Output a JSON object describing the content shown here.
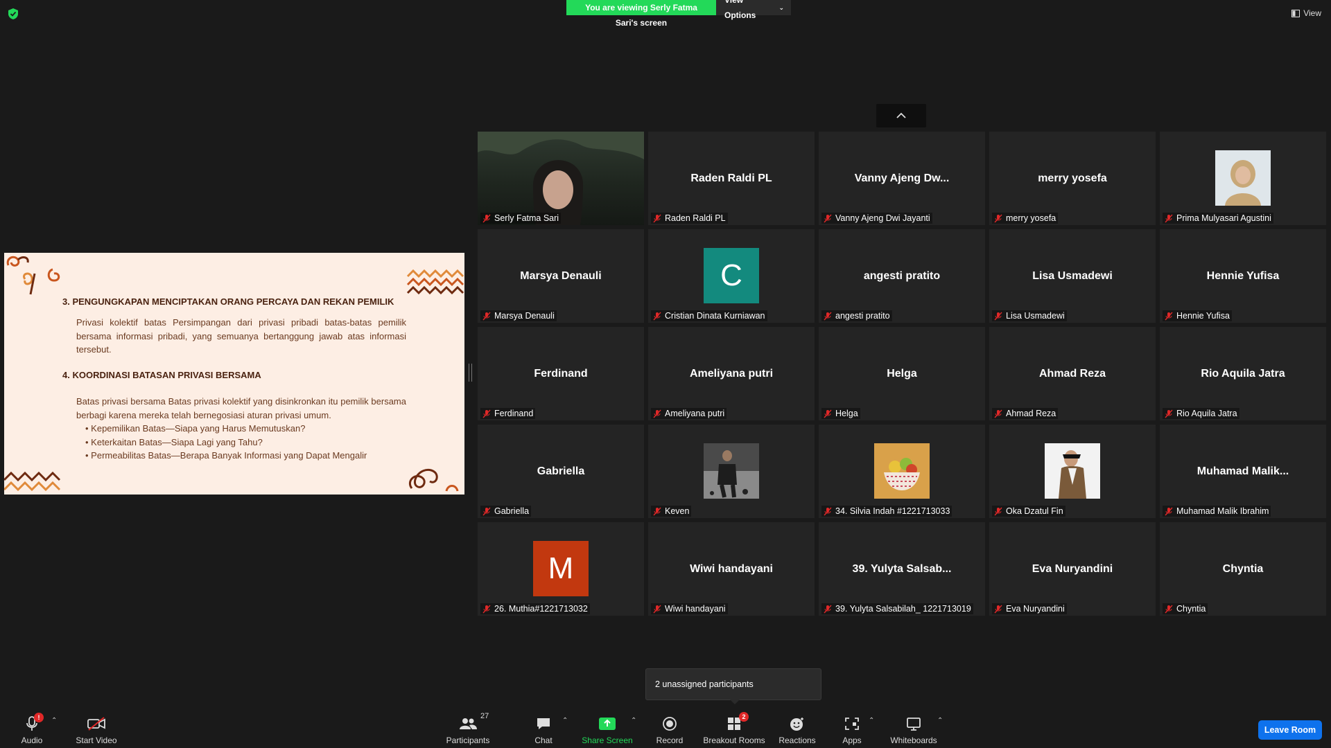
{
  "banner": {
    "viewing_text": "You are viewing Serly Fatma Sari's screen",
    "view_options_label": "View Options",
    "accent_color": "#23d959"
  },
  "view_button_label": "View",
  "slide": {
    "heading3": "3.  PENGUNGKAPAN MENCIPTAKAN ORANG PERCAYA DAN REKAN PEMILIK",
    "para3": "Privasi kolektif batas Persimpangan dari privasi pribadi batas-batas pemilik bersama informasi pribadi, yang semuanya bertanggung jawab atas informasi tersebut.",
    "heading4": "4. KOORDINASI BATASAN PRIVASI BERSAMA",
    "para4": "Batas privasi bersama Batas privasi kolektif yang disinkronkan itu pemilik bersama berbagi karena mereka telah bernegosiasi aturan privasi umum.",
    "bullets": [
      "Kepemilikan Batas—Siapa yang Harus Memutuskan?",
      "Keterkaitan Batas—Siapa Lagi yang Tahu?",
      "Permeabilitas Batas—Berapa Banyak Informasi yang Dapat Mengalir"
    ]
  },
  "participants_grid": [
    {
      "display": "",
      "label": "Serly Fatma Sari",
      "media": "video"
    },
    {
      "display": "Raden Raldi PL",
      "label": "Raden Raldi PL",
      "media": "name"
    },
    {
      "display": "Vanny  Ajeng  Dw...",
      "label": "Vanny Ajeng Dwi Jayanti",
      "media": "name"
    },
    {
      "display": "merry yosefa",
      "label": "merry yosefa",
      "media": "name"
    },
    {
      "display": "",
      "label": "Prima Mulyasari Agustini",
      "media": "photo"
    },
    {
      "display": "Marsya Denauli",
      "label": "Marsya Denauli",
      "media": "name"
    },
    {
      "display": "C",
      "label": "Cristian Dinata Kurniawan",
      "media": "letter",
      "avatar_color": "#138a7e"
    },
    {
      "display": "angesti pratito",
      "label": "angesti pratito",
      "media": "name"
    },
    {
      "display": "Lisa Usmadewi",
      "label": "Lisa Usmadewi",
      "media": "name"
    },
    {
      "display": "Hennie Yufisa",
      "label": "Hennie Yufisa",
      "media": "name"
    },
    {
      "display": "Ferdinand",
      "label": "Ferdinand",
      "media": "name"
    },
    {
      "display": "Ameliyana putri",
      "label": "Ameliyana putri",
      "media": "name"
    },
    {
      "display": "Helga",
      "label": "Helga",
      "media": "name"
    },
    {
      "display": "Ahmad Reza",
      "label": "Ahmad Reza",
      "media": "name"
    },
    {
      "display": "Rio Aquila Jatra",
      "label": "Rio Aquila Jatra",
      "media": "name"
    },
    {
      "display": "Gabriella",
      "label": "Gabriella",
      "media": "name"
    },
    {
      "display": "",
      "label": "Keven",
      "media": "photo"
    },
    {
      "display": "",
      "label": "34. Silvia Indah #1221713033",
      "media": "photo"
    },
    {
      "display": "",
      "label": "Oka Dzatul Fin",
      "media": "photo"
    },
    {
      "display": "Muhamad  Malik...",
      "label": "Muhamad Malik Ibrahim",
      "media": "name"
    },
    {
      "display": "M",
      "label": "26. Muthia#1221713032",
      "media": "letter",
      "avatar_color": "#c2380f"
    },
    {
      "display": "Wiwi handayani",
      "label": "Wiwi handayani",
      "media": "name"
    },
    {
      "display": "39. Yulyta Salsab...",
      "label": "39. Yulyta Salsabilah_ 1221713019",
      "media": "name"
    },
    {
      "display": "Eva Nuryandini",
      "label": "Eva Nuryandini",
      "media": "name"
    },
    {
      "display": "Chyntia",
      "label": "Chyntia",
      "media": "name"
    }
  ],
  "unassigned_popup": "2 unassigned participants",
  "toolbar": {
    "audio": "Audio",
    "audio_badge": "!",
    "start_video": "Start Video",
    "participants": "Participants",
    "participants_count": "27",
    "chat": "Chat",
    "share_screen": "Share Screen",
    "record": "Record",
    "breakout_rooms": "Breakout Rooms",
    "breakout_badge": "2",
    "reactions": "Reactions",
    "apps": "Apps",
    "whiteboards": "Whiteboards",
    "leave_room": "Leave Room",
    "share_color": "#23d959",
    "leave_color": "#0e72ed"
  }
}
